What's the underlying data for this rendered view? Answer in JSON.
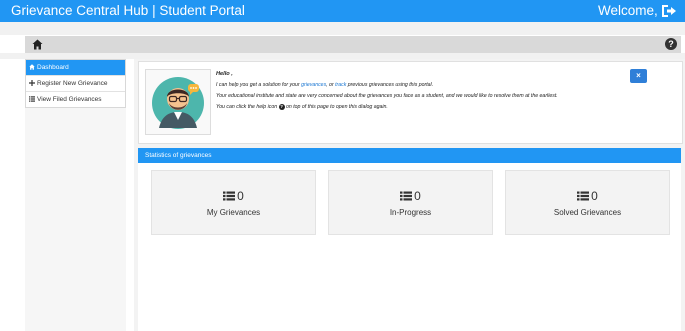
{
  "header": {
    "brand": "Grievance Central Hub | Student Portal",
    "welcome": "Welcome,",
    "logout_icon": "sign-out-icon"
  },
  "breadcrumb": {
    "home_icon": "home-icon",
    "help_icon": "question-circle-icon",
    "help_glyph": "?"
  },
  "sidebar": {
    "items": [
      {
        "label": "Dashboard",
        "icon": "home-icon",
        "active": true
      },
      {
        "label": "Register New Grievance",
        "icon": "plus-icon",
        "active": false
      },
      {
        "label": "View Filed Grievances",
        "icon": "list-icon",
        "active": false
      }
    ]
  },
  "welcome_box": {
    "greeting": "Hello ,",
    "line1_pre": "I can help you get a solution for your ",
    "line1_link1": "grievances",
    "line1_mid": ", or ",
    "line1_link2": "track",
    "line1_post": " previous grievances using this portal.",
    "line2": "Your educational institute and state are very concerned about the grievances you face as a student, and we would like to resolve them at the earliest.",
    "line3_pre": "You can click the help icon ",
    "line3_icon": "?",
    "line3_post": " on top of this page to open this dialog again.",
    "close_label": "×",
    "avatar_icon": "avatar-icon"
  },
  "stats": {
    "title": "Statistics of grievances",
    "cards": [
      {
        "count": "0",
        "label": "My Grievances",
        "icon": "list-icon"
      },
      {
        "count": "0",
        "label": "In-Progress",
        "icon": "list-icon"
      },
      {
        "count": "0",
        "label": "Solved Grievances",
        "icon": "list-icon"
      }
    ]
  },
  "colors": {
    "primary": "#2196f3",
    "active_nav": "#2196f3",
    "close_button": "#2f7fd8",
    "card_bg": "#f3f3f3"
  }
}
